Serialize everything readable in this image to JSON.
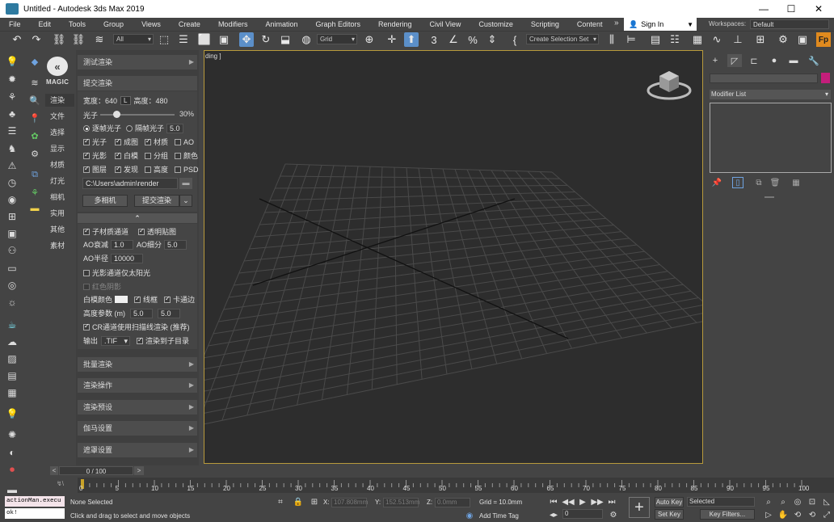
{
  "window": {
    "title": "Untitled - Autodesk 3ds Max 2019",
    "minimize": "—",
    "maximize": "☐",
    "close": "✕"
  },
  "menu": [
    "File",
    "Edit",
    "Tools",
    "Group",
    "Views",
    "Create",
    "Modifiers",
    "Animation",
    "Graph Editors",
    "Rendering",
    "Civil View",
    "Customize",
    "Scripting",
    "Content"
  ],
  "menu_overflow": "»",
  "signin": "Sign In",
  "workspaces": {
    "label": "Workspaces:",
    "value": "Default"
  },
  "toolbar": {
    "filter_select": "All",
    "coord_select": "Grid",
    "named_selection": "Create Selection Set"
  },
  "magic": {
    "logo_text": "MAGIC",
    "nav": [
      "渲染",
      "文件",
      "选择",
      "显示",
      "材质",
      "灯光",
      "相机",
      "实用",
      "其他",
      "素材"
    ]
  },
  "render_panel": {
    "section_test": "测试渲染",
    "section_submit": "提交渲染",
    "width_label": "宽度：",
    "width_value": "640",
    "lock_label": "L",
    "height_label": "高度：",
    "height_value": "480",
    "photon_label": "光子",
    "photon_value": "30%",
    "radio_per_frame": "逐帧光子",
    "radio_every_n": "隔帧光子",
    "every_n_value": "5.0",
    "checks_row1": [
      {
        "label": "光子",
        "on": true
      },
      {
        "label": "成图",
        "on": true
      },
      {
        "label": "材质",
        "on": true
      },
      {
        "label": "AO",
        "on": false
      }
    ],
    "checks_row2": [
      {
        "label": "光影",
        "on": true
      },
      {
        "label": "白模",
        "on": true
      },
      {
        "label": "分组",
        "on": false
      },
      {
        "label": "颜色",
        "on": false
      }
    ],
    "checks_row3": [
      {
        "label": "图层",
        "on": true
      },
      {
        "label": "发现",
        "on": true
      },
      {
        "label": "高度",
        "on": false
      },
      {
        "label": "PSD",
        "on": false
      }
    ],
    "output_path": "C:\\Users\\admin\\render",
    "multi_camera_button": "多相机",
    "submit_button": "提交渲染",
    "collapse_arrow": "⌃",
    "sub_material_channel": "子材质通道",
    "transparent_map": "透明贴图",
    "ao_falloff_label": "AO衰减",
    "ao_falloff_value": "1.0",
    "ao_subdiv_label": "AO细分",
    "ao_subdiv_value": "5.0",
    "ao_radius_label": "AO半径",
    "ao_radius_value": "10000",
    "light_channel_sun_only": "光影通道仅太阳光",
    "red_shadow": "红色阴影",
    "white_model_color_label": "白模颜色",
    "wireframe": "线框",
    "card_edge": "卡通边",
    "height_param_label": "高度参数 (m)",
    "height_param_a": "5.0",
    "height_param_b": "5.0",
    "cr_channel": "CR通道使用扫描线渲染 (推荐)",
    "output_label": "输出",
    "output_format": ".TIF",
    "render_to_subdir": "渲染到子目录",
    "sections_bottom": [
      "批量渲染",
      "渲染操作",
      "渲染预设",
      "伽马设置",
      "遮罩设置"
    ]
  },
  "viewport": {
    "label": "ding ]"
  },
  "command_panel": {
    "modifier_list": "Modifier List"
  },
  "timeslider": {
    "value": "0 / 100",
    "prev": "<",
    "next": ">"
  },
  "trackbar": {
    "ticks": [
      "0",
      "5",
      "10",
      "15",
      "20",
      "25",
      "30",
      "35",
      "40",
      "45",
      "50",
      "55",
      "60",
      "65",
      "70",
      "75",
      "80",
      "85",
      "90",
      "95",
      "100"
    ]
  },
  "status": {
    "maxscript_line1": "actionMan.execu",
    "maxscript_line2": "ok!",
    "selection": "None Selected",
    "prompt": "Click and drag to select and move objects",
    "x_label": "X:",
    "x_value": "107.808mm",
    "y_label": "Y:",
    "y_value": "152.513mm",
    "z_label": "Z:",
    "z_value": "0.0mm",
    "grid": "Grid = 10.0mm",
    "add_time_tag": "Add Time Tag",
    "auto_key": "Auto Key",
    "auto_key_select": "Selected",
    "set_key": "Set Key",
    "key_filters": "Key Filters...",
    "frame_value": "0"
  },
  "colors": {
    "accent_blue": "#5b8fc9",
    "viewport_border": "#b89a3c",
    "color_swatch": "#c41e7b"
  }
}
